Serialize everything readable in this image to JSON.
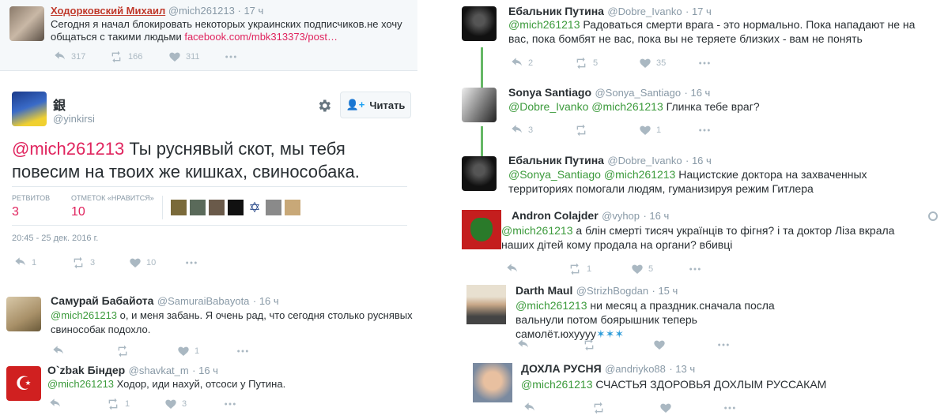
{
  "colors": {
    "mention": "#3b9a3b",
    "link": "#e0245e",
    "muted": "#8899a6",
    "red_num": "#e0245e"
  },
  "top_tweet": {
    "name": "Ходорковский Михаил",
    "handle": "@mich261213",
    "time": "· 17 ч",
    "text": "Сегодня я начал блокировать некоторых украинских подписчиков.не хочу общаться с такими людьми ",
    "link": "facebook.com/mbk313373/post…",
    "retweets": "317",
    "likes": "166",
    "replies": "311"
  },
  "main_tweet": {
    "name": "銀",
    "handle": "@yinkirsi",
    "follow_label": "Читать",
    "mention": "@mich261213",
    "text": " Ты руснявый скот, мы тебя повесим на твоих же кишках, свинособака.",
    "retweets_label": "РЕТВИТОВ",
    "retweets": "3",
    "likes_label": "ОТМЕТОК «НРАВИТСЯ»",
    "likes": "10",
    "datetime": "20:45 - 25 дек. 2016 г.",
    "reply_count": "1",
    "rt_count": "3",
    "like_count": "10"
  },
  "left_replies": [
    {
      "name": "Самурай Бабайота",
      "handle": "@SamuraiBabayota",
      "time": "· 16 ч",
      "mention": "@mich261213",
      "text": " о, и меня забань. Я очень рад, что сегодня столько руснявых свинособак подохло.",
      "like_count": "1"
    },
    {
      "name": "O`zbak Бiндер",
      "handle": "@shavkat_m",
      "time": "· 16 ч",
      "mention": "@mich261213",
      "text": " Ходор, иди нахуй, отсоси у Путина.",
      "rt_count": "1",
      "like_count": "3"
    }
  ],
  "right_thread": [
    {
      "name": "Ебальник Путина",
      "handle": "@Dobre_Ivanko",
      "time": "· 17 ч",
      "mention": "@mich261213",
      "text": " Радоваться смерти врага - это нормально. Пока нападают не на вас, пока бомбят не вас, пока вы не теряете близких - вам не понять",
      "reply_count": "2",
      "rt_count": "5",
      "like_count": "35"
    },
    {
      "name": "Sonya Santiago",
      "handle": "@Sonya_Santiago",
      "time": "· 16 ч",
      "mention": "@Dobre_Ivanko @mich261213",
      "text": " Глинка тебе враг?",
      "reply_count": "3",
      "like_count": "1"
    },
    {
      "name": "Ебальник Путина",
      "handle": "@Dobre_Ivanko",
      "time": "· 16 ч",
      "mention": "@Sonya_Santiago @mich261213",
      "text": " Нацистские доктора на захваченных территориях помогали людям, гуманизируя режим Гитлера"
    },
    {
      "name": "Andron Colajder",
      "handle": "@vyhop",
      "time": "· 16 ч",
      "mention": "@mich261213",
      "text": " а блін смерті тисяч українців то фігня? і та доктор Ліза вкрала наших дітей кому продала на органи? вбивці",
      "rt_count": "1",
      "like_count": "5"
    },
    {
      "name": "Darth Maul",
      "handle": "@StrizhBogdan",
      "time": "· 15 ч",
      "mention": "@mich261213",
      "text": " ни месяц а праздник.сначала посла вальнули потом боярышник теперь самолёт.юхуууу"
    },
    {
      "name": "ДОХЛА РУСНЯ",
      "handle": "@andriyko88",
      "time": "· 13 ч",
      "mention": "@mich261213",
      "text": " СЧАСТЬЯ ЗДОРОВЬЯ ДОХЛЫМ РУССАКАМ"
    }
  ]
}
